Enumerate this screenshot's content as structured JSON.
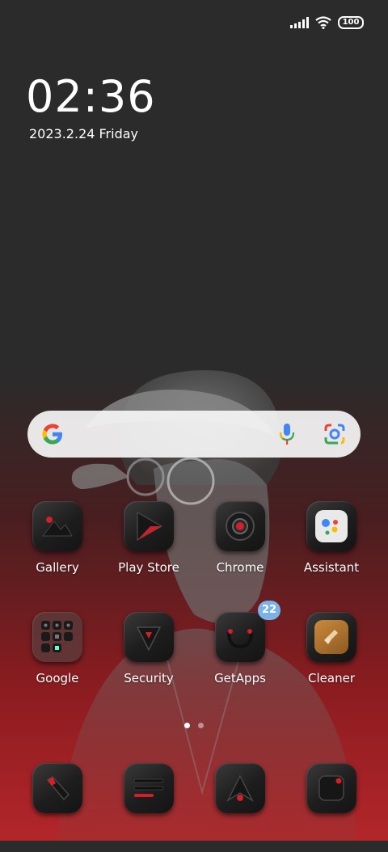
{
  "status_bar": {
    "battery": "100",
    "icons": [
      "signal-icon",
      "wifi-icon",
      "battery-icon"
    ]
  },
  "lockscreen": {
    "time": "02:36",
    "date": "2023.2.24 Friday"
  },
  "search_bar": {
    "icons": [
      "google-g-icon",
      "microphone-icon",
      "google-lens-icon"
    ]
  },
  "apps_row1": [
    {
      "label": "Gallery",
      "icon": "gallery-icon"
    },
    {
      "label": "Play Store",
      "icon": "play-store-icon"
    },
    {
      "label": "Chrome",
      "icon": "chrome-icon"
    },
    {
      "label": "Assistant",
      "icon": "assistant-icon"
    }
  ],
  "apps_row2": [
    {
      "label": "Google",
      "icon": "google-folder-icon"
    },
    {
      "label": "Security",
      "icon": "security-icon"
    },
    {
      "label": "GetApps",
      "icon": "getapps-icon",
      "badge": "22"
    },
    {
      "label": "Cleaner",
      "icon": "cleaner-icon"
    }
  ],
  "dock": [
    {
      "icon": "phone-icon"
    },
    {
      "icon": "messages-icon"
    },
    {
      "icon": "browser-icon"
    },
    {
      "icon": "camera-icon"
    }
  ],
  "page_indicator": {
    "pages": 2,
    "current": 1
  },
  "colors": {
    "accent_red": "#d0202a",
    "badge_blue": "#7ab2ea",
    "tile_dark": "#1d1d1d"
  }
}
